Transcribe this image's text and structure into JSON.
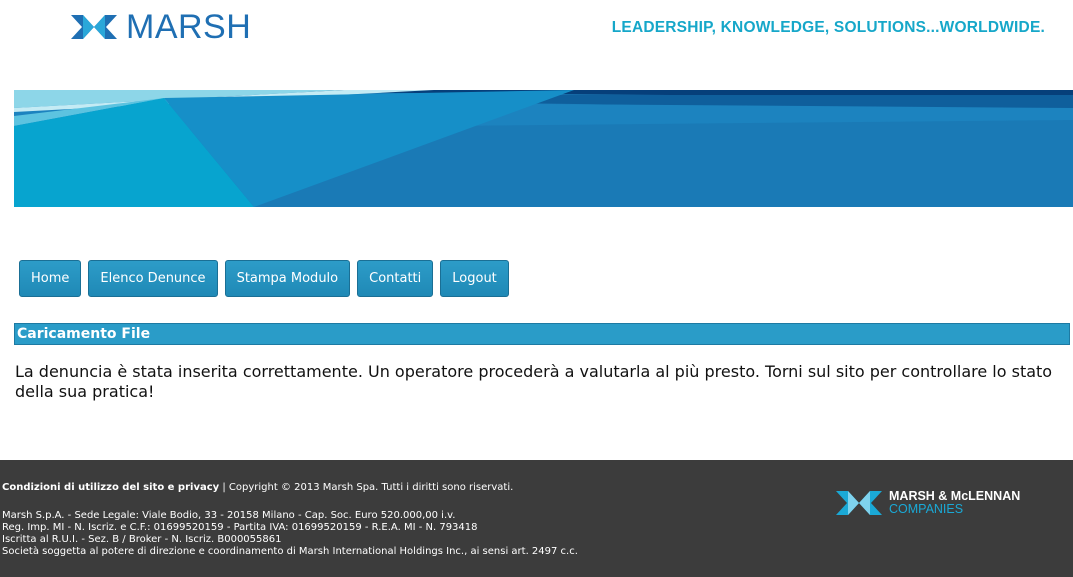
{
  "header": {
    "logo_text": "MARSH",
    "tagline": "LEADERSHIP, KNOWLEDGE, SOLUTIONS...WORLDWIDE."
  },
  "nav": {
    "items": [
      "Home",
      "Elenco Denunce",
      "Stampa Modulo",
      "Contatti",
      "Logout"
    ]
  },
  "section": {
    "title": "Caricamento File"
  },
  "main": {
    "message": "La denuncia è stata inserita correttamente. Un operatore procederà a valutarla al più presto. Torni sul sito per controllare lo stato della sua pratica!"
  },
  "footer": {
    "terms_link": "Condizioni di utilizzo del sito e privacy",
    "separator": "|",
    "copyright": "Copyright © 2013 Marsh Spa. Tutti i diritti sono riservati.",
    "lines": [
      "Marsh S.p.A. - Sede Legale: Viale Bodio, 33 - 20158 Milano - Cap. Soc. Euro 520.000,00 i.v.",
      "Reg. Imp. MI - N. Iscriz. e C.F.: 01699520159 - Partita IVA: 01699520159 - R.E.A. MI - N. 793418",
      "Iscritta al R.U.I. - Sez. B / Broker - N. Iscriz. B000055861",
      "Società soggetta al potere di direzione e coordinamento di Marsh International Holdings Inc., ai sensi art. 2497 c.c."
    ],
    "mmc_line1": "MARSH & McLENNAN",
    "mmc_line2": "COMPANIES"
  },
  "colors": {
    "brand_blue": "#1f6fb3",
    "tagline_cyan": "#16a7c9",
    "button_blue": "#2d9cc8",
    "footer_bg": "#3c3c3c"
  },
  "icons": {
    "logo": "marsh-logo-icon",
    "mmc_logo": "mmc-logo-icon"
  }
}
